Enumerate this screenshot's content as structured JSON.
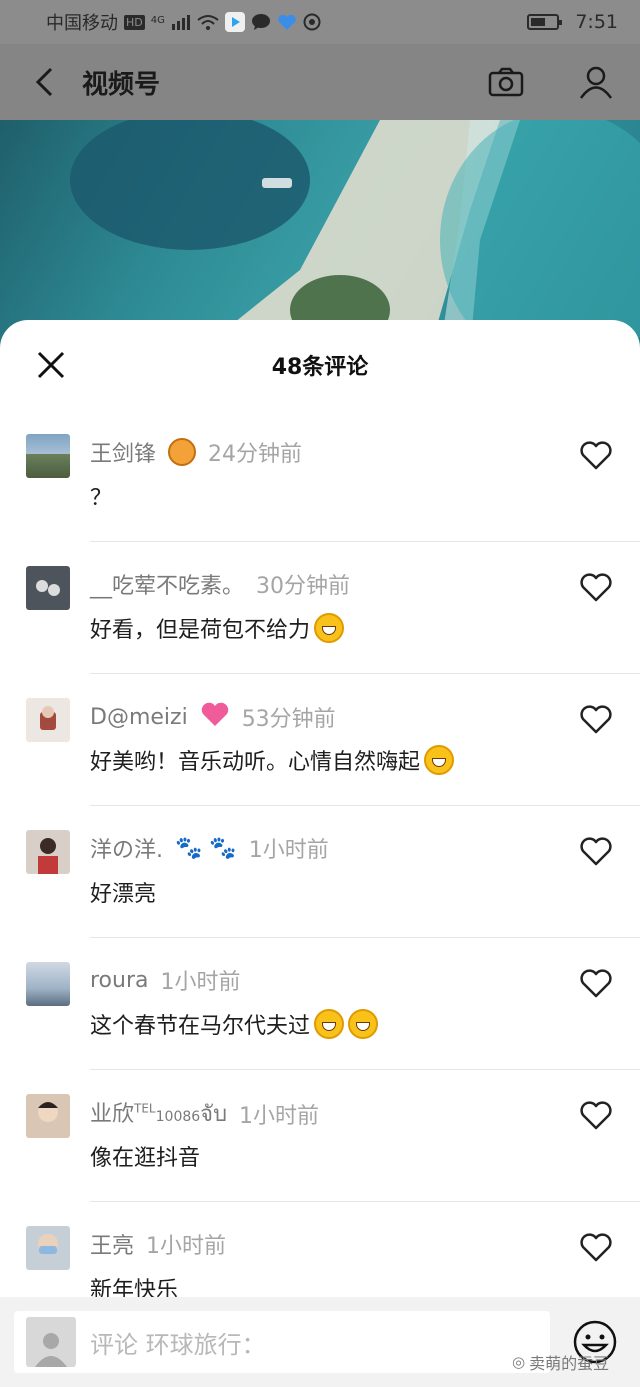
{
  "status_bar": {
    "carrier": "中国移动",
    "hd_badge": "HD",
    "network": "4G",
    "time": "7:51",
    "battery_level": 0.55
  },
  "nav": {
    "back_icon": "chevron-left-icon",
    "title": "视频号",
    "camera_icon": "camera-icon",
    "profile_icon": "person-icon"
  },
  "sheet": {
    "title": "48条评论",
    "close_icon": "close-icon"
  },
  "comments": [
    {
      "name": "王剑锋",
      "time": "24分钟前",
      "text": "？",
      "name_emoji": "tiger-emoji",
      "avatar_color": "#6f8fa8"
    },
    {
      "name": "__吃荤不吃素。",
      "time": "30分钟前",
      "text": "好看，但是荷包不给力",
      "text_emoji": "laughing-crying-emoji",
      "avatar_color": "#5b6068"
    },
    {
      "name": "D@meizi",
      "time": "53分钟前",
      "text": "好美哟！音乐动听。心情自然嗨起",
      "name_emoji": "sparkling-heart-emoji",
      "text_emoji": "winking-tongue-emoji",
      "avatar_color": "#e9e3de"
    },
    {
      "name": "洋の洋.",
      "time": "1小时前",
      "text": "好漂亮",
      "name_emoji": "paw-prints-emoji",
      "avatar_color": "#c9b6a8"
    },
    {
      "name": "roura",
      "time": "1小时前",
      "text": "这个春节在马尔代夫过",
      "text_emoji": "grinning-emoji",
      "avatar_color": "#8ea0b5"
    },
    {
      "name_main": "业欣",
      "name_tel": "TEL",
      "name_digits": "10086",
      "name_tail": "จับ",
      "time": "1小时前",
      "text": "像在逛抖音",
      "avatar_color": "#7d6a5c"
    },
    {
      "name": "王亮",
      "time": "1小时前",
      "text": "新年快乐",
      "avatar_color": "#5c6f7e"
    }
  ],
  "like_icon": "heart-outline-icon",
  "input_bar": {
    "placeholder": "评论 环球旅行：",
    "emoji_button_icon": "smiley-icon"
  },
  "watermark": "卖萌的蚕豆"
}
